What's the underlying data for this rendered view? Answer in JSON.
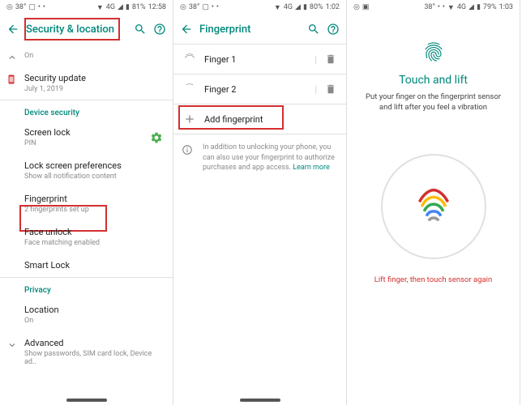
{
  "statusbar": {
    "temp": "38°",
    "battery1": "81%",
    "time1": "12:58",
    "battery2": "80%",
    "time2": "1:02",
    "battery3": "79%",
    "time3": "1:03",
    "sig": "4G"
  },
  "screen1": {
    "title": "Security & location",
    "items": {
      "statusOn": "On",
      "update_title": "Security update",
      "update_sub": "July 1, 2019",
      "section_device": "Device security",
      "screenlock_title": "Screen lock",
      "screenlock_sub": "PIN",
      "lockpref_title": "Lock screen preferences",
      "lockpref_sub": "Show all notification content",
      "fingerprint_title": "Fingerprint",
      "fingerprint_sub": "2 fingerprints set up",
      "faceunlock_title": "Face unlock",
      "faceunlock_sub": "Face matching enabled",
      "smartlock_title": "Smart Lock",
      "section_privacy": "Privacy",
      "location_title": "Location",
      "location_sub": "On",
      "advanced_title": "Advanced",
      "advanced_sub": "Show passwords, SIM card lock, Device ad.."
    }
  },
  "screen2": {
    "title": "Fingerprint",
    "finger1": "Finger 1",
    "finger2": "Finger 2",
    "add": "Add fingerprint",
    "info": "In addition to unlocking your phone, you can also use your fingerprint to authorize purchases and app access.",
    "learn_more": "Learn more"
  },
  "screen3": {
    "title": "Touch and lift",
    "desc": "Put your finger on the fingerprint sensor and lift after you feel a vibration",
    "warn": "Lift finger, then touch sensor again"
  }
}
